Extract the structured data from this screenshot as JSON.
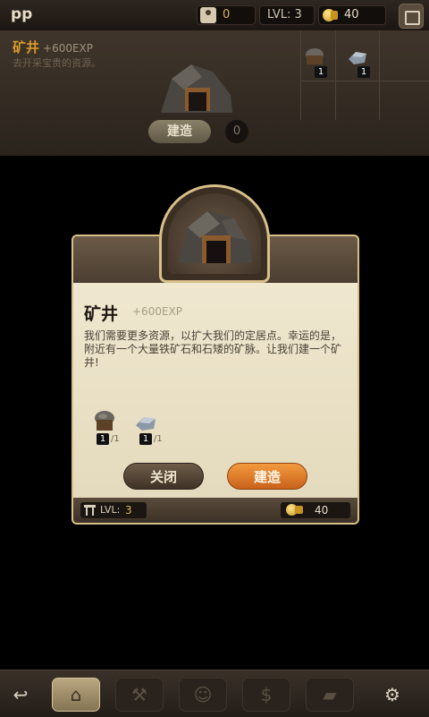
{
  "topbar": {
    "player_name": "pp",
    "population": "0",
    "level": "LVL: 3",
    "coins": "40",
    "icons": [
      "person-icon",
      "coin-icon",
      "backpack-icon"
    ]
  },
  "background_building": {
    "title": "矿井",
    "exp": "+600EXP",
    "description": "去开采宝贵的资源。",
    "resource_counts": [
      "1",
      "1"
    ],
    "build_label": "建造",
    "count": "0"
  },
  "dialog": {
    "title": "矿井",
    "exp": "+600EXP",
    "description": "我们需要更多资源，以扩大我们的定居点。幸运的是，附近有一个大量铁矿石和石矮的矿脉。让我们建一个矿井!",
    "resources": [
      {
        "name": "stone",
        "have": "1",
        "need": "/1"
      },
      {
        "name": "iron",
        "have": "1",
        "need": "/1"
      }
    ],
    "close_label": "关闭",
    "build_label": "建造",
    "footer_level_label": "LVL:",
    "footer_level_value": "3",
    "footer_cost": "40"
  },
  "toolbar": {
    "items": [
      "back-icon",
      "house-icon",
      "hammer-icon",
      "worker-icon",
      "money-icon",
      "resource-icon",
      "settings-icon"
    ],
    "active": "house-icon"
  },
  "colors": {
    "accent_orange": "#e07a26",
    "gold_text": "#d7b35a",
    "parchment": "#ece3c9",
    "dark_wood": "#3a2f24"
  }
}
